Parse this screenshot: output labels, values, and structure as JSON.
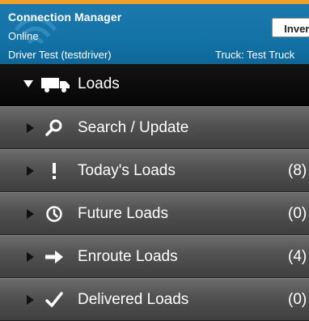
{
  "app": {
    "title": "Connection Manager",
    "status": "Online",
    "driver": "Driver Test (testdriver)",
    "truck": "Truck: Test Truck",
    "invert_label": "Invert"
  },
  "colors": {
    "accent_strip": "#f0a028",
    "header_blue": "#1372a6",
    "menu_gray": "#515151"
  },
  "loads": {
    "label": "Loads",
    "icon": "truck-icon"
  },
  "menu": [
    {
      "label": "Search / Update",
      "count": "",
      "icon": "magnifier-icon"
    },
    {
      "label": "Today's Loads",
      "count": "(8)",
      "icon": "exclamation-icon"
    },
    {
      "label": "Future Loads",
      "count": "(0)",
      "icon": "clock-icon"
    },
    {
      "label": "Enroute Loads",
      "count": "(4)",
      "icon": "arrow-right-icon"
    },
    {
      "label": "Delivered Loads",
      "count": "(0)",
      "icon": "checkmark-icon"
    }
  ]
}
